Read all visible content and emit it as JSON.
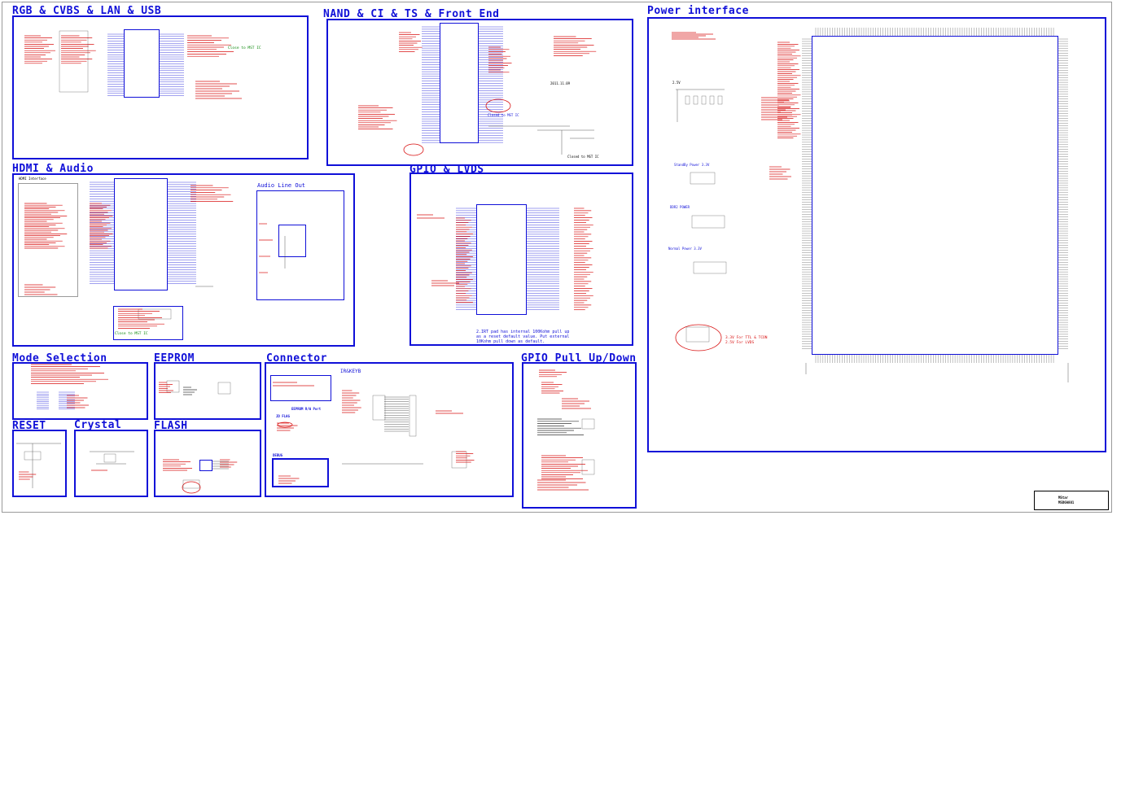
{
  "sections": {
    "rgb": "RGB & CVBS & LAN & USB",
    "nand": "NAND & CI & TS & Front End",
    "power": "Power interface",
    "hdmi": "HDMI & Audio",
    "gpio_lvds": "GPIO & LVDS",
    "mode": "Mode Selection",
    "eeprom": "EEPROM",
    "connector": "Connector",
    "gpio_pull": "GPIO Pull Up/Down",
    "reset": "RESET",
    "crystal": "Crystal",
    "flash": "FLASH"
  },
  "annotations": {
    "audio_line_out": "Audio Line Out",
    "hdmi_interface": "HDMI Interface",
    "ir_keyb": "IR&KEYB",
    "eeprom_rw_port": "EEPROM R/W Port",
    "jd_flag": "JD FLAG",
    "debug": "DEBUG",
    "date": "2011.11.09",
    "closed_to_mst": "Closed to MST IC",
    "closed_to_mst2": "Closed to MST IC",
    "standby_power": "StandBy Power 3.3V",
    "ddr2_power": "DDR2 POWER",
    "normal_power": "Normal Power 3.3V",
    "v25": "2.5V",
    "lvds_note_1": "3.3V For TTL & TCON",
    "lvds_note_2": "2.5V For LVDS",
    "gpio_note_1": "2.IRT pad has internal 100Kohm pull up",
    "gpio_note_2": "as a reset default value. Put external",
    "gpio_note_3": "10Kohm pull down as default.",
    "close_mst": "Close to MST IC",
    "close_mst_hdmi": "Close to MST IC"
  },
  "title_block": {
    "company": "MStar",
    "model": "MSD6A801"
  }
}
